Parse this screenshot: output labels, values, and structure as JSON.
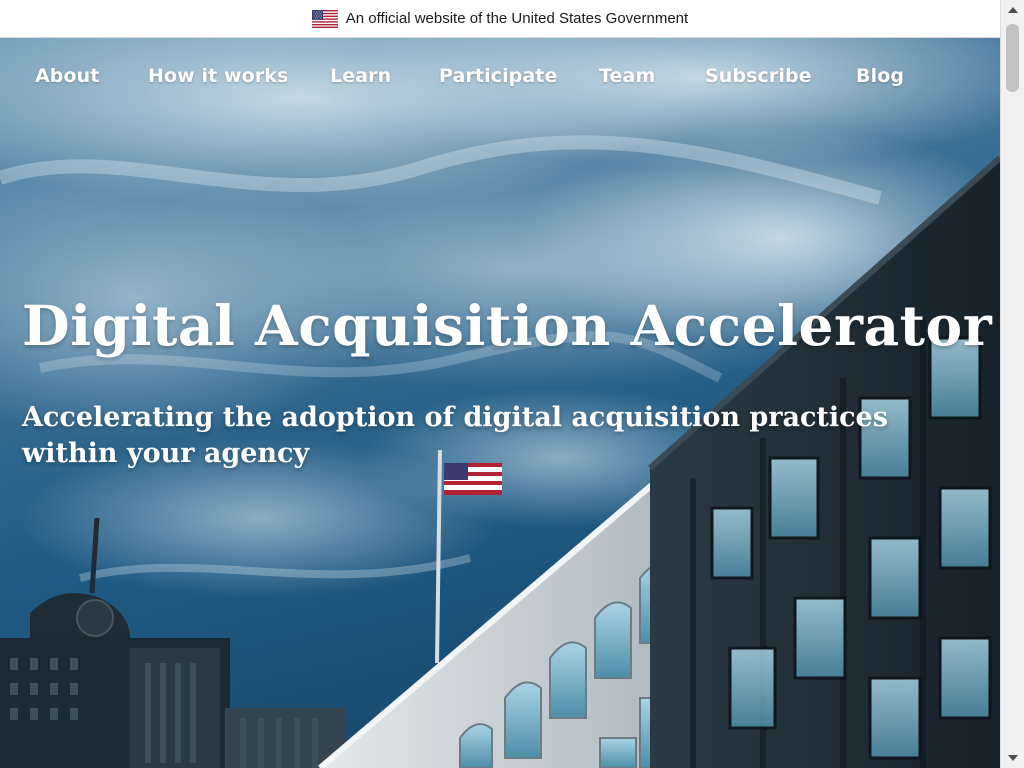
{
  "gov_banner": {
    "text": "An official website of the United States Government",
    "icon": "us-flag-icon"
  },
  "nav": {
    "items": [
      {
        "label": "About"
      },
      {
        "label": "How it works"
      },
      {
        "label": "Learn"
      },
      {
        "label": "Participate"
      },
      {
        "label": "Team"
      },
      {
        "label": "Subscribe"
      },
      {
        "label": "Blog"
      }
    ]
  },
  "hero": {
    "title": "Digital Acquisition Accelerator",
    "subtitle": "Accelerating the adoption of digital acquisition practices within your agency"
  },
  "colors": {
    "sky_dark": "#1d4f72",
    "sky_light": "#9dbdd2",
    "building_dark": "#1e2a33",
    "building_light": "#cfd6da",
    "text": "#ffffff"
  },
  "scrollbar": {
    "up_icon": "chevron-up-icon",
    "down_icon": "chevron-down-icon"
  }
}
